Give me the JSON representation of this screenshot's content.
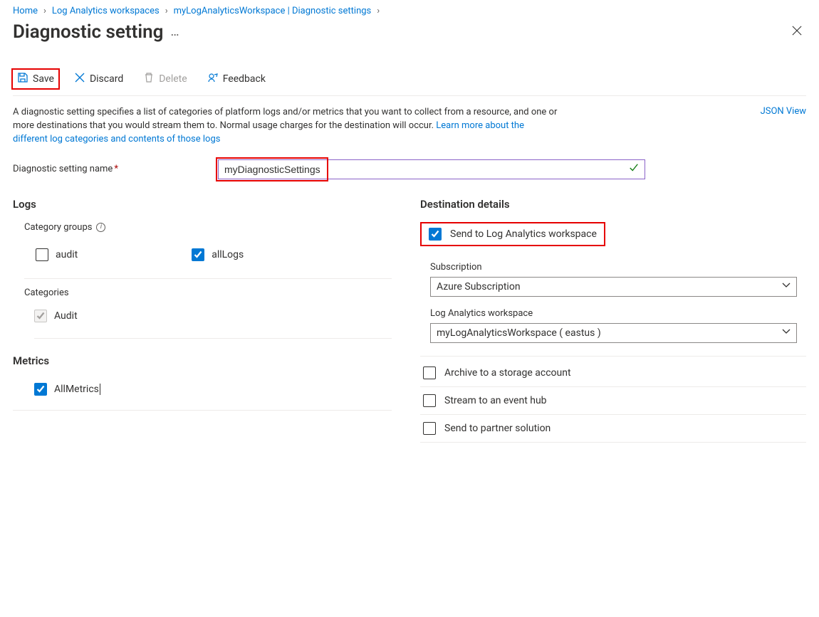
{
  "breadcrumb": {
    "items": [
      "Home",
      "Log Analytics workspaces",
      "myLogAnalyticsWorkspace | Diagnostic settings"
    ]
  },
  "page": {
    "title": "Diagnostic setting"
  },
  "toolbar": {
    "save": "Save",
    "discard": "Discard",
    "delete": "Delete",
    "feedback": "Feedback"
  },
  "intro": {
    "text_part1": "A diagnostic setting specifies a list of categories of platform logs and/or metrics that you want to collect from a resource, and one or more destinations that you would stream them to. Normal usage charges for the destination will occur. ",
    "link_text": "Learn more about the different log categories and contents of those logs",
    "json_view": "JSON View"
  },
  "form": {
    "name_label": "Diagnostic setting name",
    "name_value": "myDiagnosticSettings"
  },
  "logs": {
    "heading": "Logs",
    "category_groups_label": "Category groups",
    "group_audit": "audit",
    "group_allLogs": "allLogs",
    "categories_label": "Categories",
    "category_audit": "Audit"
  },
  "metrics": {
    "heading": "Metrics",
    "all_metrics": "AllMetrics"
  },
  "destination": {
    "heading": "Destination details",
    "send_law": "Send to Log Analytics workspace",
    "subscription_label": "Subscription",
    "subscription_value": "Azure Subscription",
    "workspace_label": "Log Analytics workspace",
    "workspace_value": "myLogAnalyticsWorkspace ( eastus )",
    "archive_storage": "Archive to a storage account",
    "stream_eventhub": "Stream to an event hub",
    "send_partner": "Send to partner solution"
  }
}
